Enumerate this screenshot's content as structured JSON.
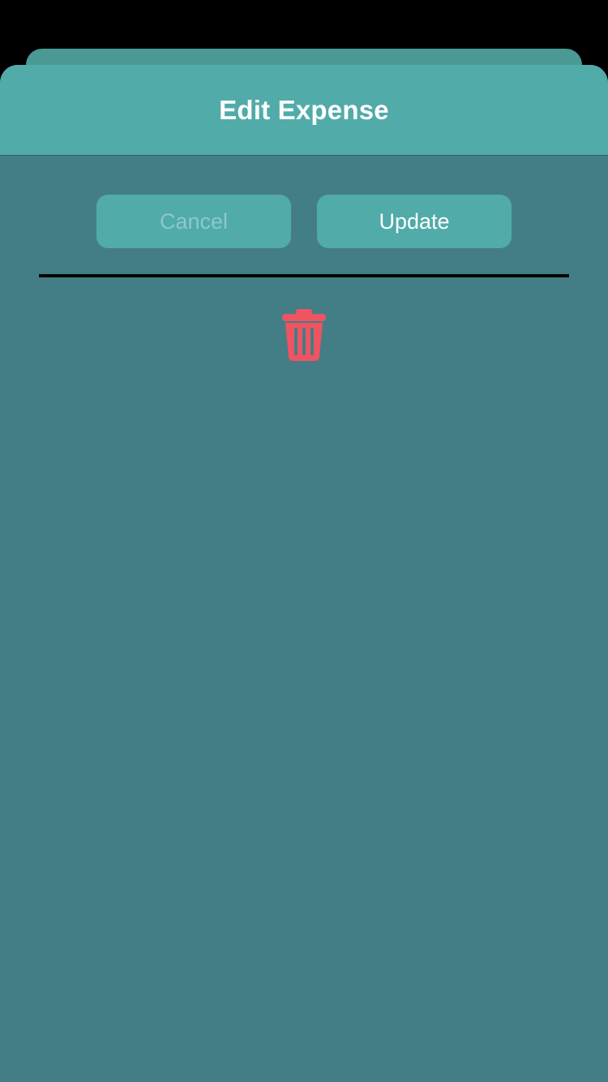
{
  "sheet": {
    "title": "Edit Expense"
  },
  "actions": {
    "cancel_label": "Cancel",
    "update_label": "Update"
  },
  "icons": {
    "delete": "trash-icon"
  },
  "colors": {
    "header": "#51aba8",
    "body": "#437e86",
    "button": "#51aba8",
    "cancel_text": "#8cc7d4",
    "update_text": "#ffffff",
    "delete_icon": "#f05361"
  }
}
